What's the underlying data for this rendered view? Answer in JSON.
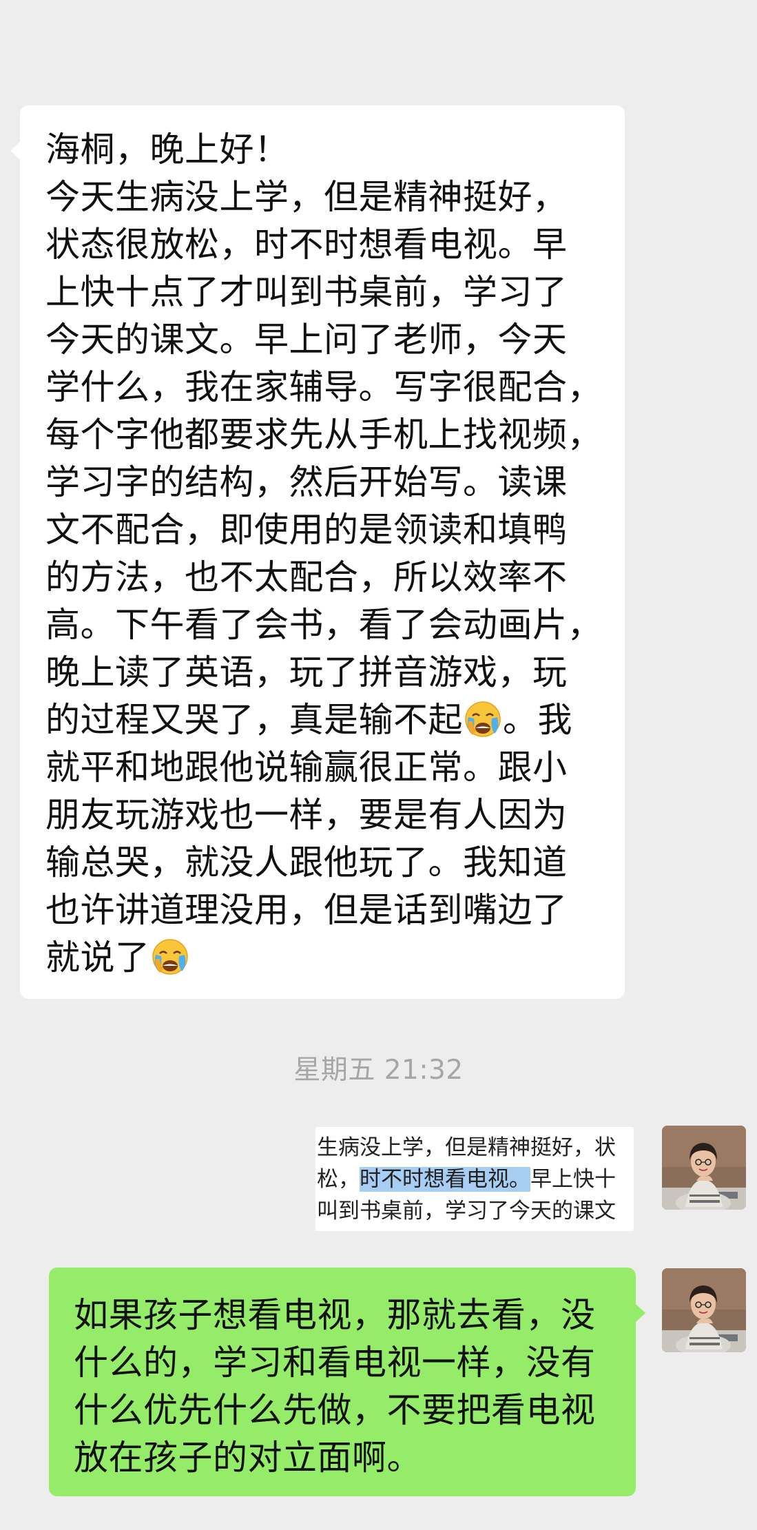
{
  "incoming_message": {
    "part1": "海桐，晚上好！\n今天生病没上学，但是精神挺好，\n状态很放松，时不时想看电视。早\n上快十点了才叫到书桌前，学习了\n今天的课文。早上问了老师，今天\n学什么，我在家辅导。写字很配合，\n每个字他都要求先从手机上找视频，\n学习字的结构，然后开始写。读课\n文不配合，即使用的是领读和填鸭\n的方法，也不太配合，所以效率不\n高。下午看了会书，看了会动画片，\n晚上读了英语，玩了拼音游戏，玩\n的过程又哭了，真是输不起",
    "part2": "。我\n就平和地跟他说输赢很正常。跟小\n朋友玩游戏也一样，要是有人因为\n输总哭，就没人跟他玩了。我知道\n也许讲道理没用，但是话到嘴边了\n就说了",
    "emoji_icon": "loudly-crying-face-emoji"
  },
  "timestamp": "星期五 21:32",
  "quoted_excerpt": {
    "line1": "生病没上学，但是精神挺好，状",
    "line2_before": "松，",
    "line2_highlight": "时不时想看电视。",
    "line2_after": "早上快十",
    "line3": "叫到书桌前，学习了今天的课文"
  },
  "outgoing_message": {
    "text": "如果孩子想看电视，那就去看，没\n什么的，学习和看电视一样，没有\n什么优先什么先做，不要把看电视\n放在孩子的对立面啊。"
  },
  "colors": {
    "background": "#ededed",
    "incoming_bubble": "#ffffff",
    "outgoing_bubble": "#95ec69",
    "highlight": "#a8cdf3",
    "timestamp": "#a6a6a6"
  }
}
